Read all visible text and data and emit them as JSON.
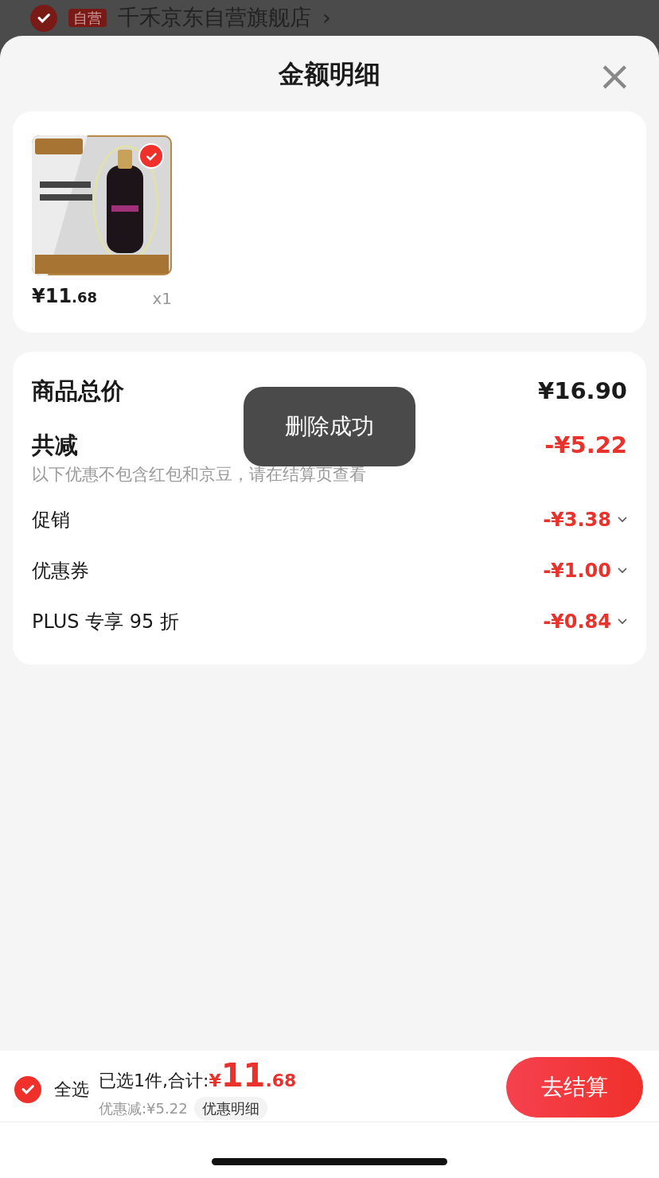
{
  "background": {
    "store": {
      "checked": true,
      "badge": "自营",
      "name": "千禾京东自营旗舰店",
      "chevron": "›"
    }
  },
  "sheet": {
    "title": "金额明细",
    "close": "×"
  },
  "products": [
    {
      "kind": "picture",
      "checked": true,
      "price_main": "¥11",
      "price_decimal": ".68",
      "quantity": "x1"
    }
  ],
  "summary": {
    "total_label": "商品总价",
    "total": "¥16.90",
    "reduce_label": "共减",
    "reduce": "-¥5.22",
    "note": "以下优惠不包含红包和京豆，请在结算页查看",
    "discounts": [
      {
        "label": "促销",
        "amount": "-¥3.38"
      },
      {
        "label": "优惠券",
        "amount": "-¥1.00"
      },
      {
        "label": "PLUS 专享 95 折",
        "amount": "-¥0.84"
      }
    ]
  },
  "toast": "删除成功",
  "bottom_bar": {
    "select_all": {
      "label": "全选",
      "checked": true
    },
    "selected_text": "已选1件,合计:",
    "currency": "¥",
    "total_main": "11",
    "total_decimal": ".68",
    "saving": "优惠减:¥5.22",
    "detail_button": "优惠明细",
    "checkout": "去结算"
  }
}
